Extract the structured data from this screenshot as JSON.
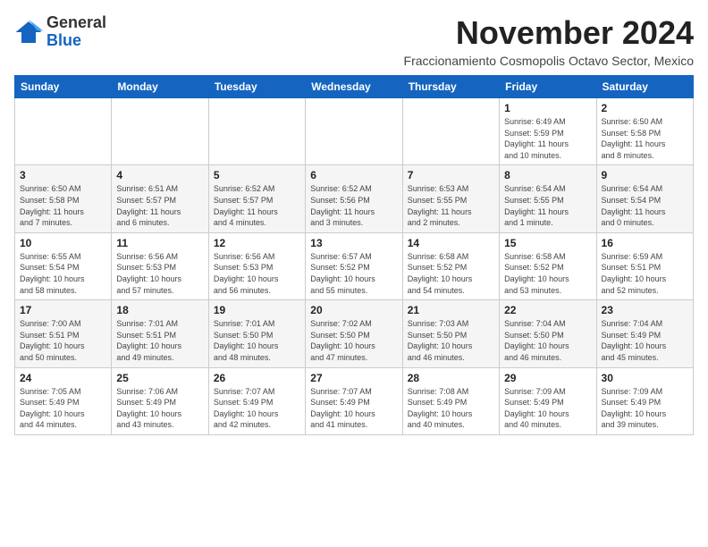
{
  "header": {
    "logo_general": "General",
    "logo_blue": "Blue",
    "month_title": "November 2024",
    "subtitle": "Fraccionamiento Cosmopolis Octavo Sector, Mexico"
  },
  "days_of_week": [
    "Sunday",
    "Monday",
    "Tuesday",
    "Wednesday",
    "Thursday",
    "Friday",
    "Saturday"
  ],
  "weeks": [
    [
      {
        "day": "",
        "info": ""
      },
      {
        "day": "",
        "info": ""
      },
      {
        "day": "",
        "info": ""
      },
      {
        "day": "",
        "info": ""
      },
      {
        "day": "",
        "info": ""
      },
      {
        "day": "1",
        "info": "Sunrise: 6:49 AM\nSunset: 5:59 PM\nDaylight: 11 hours and 10 minutes."
      },
      {
        "day": "2",
        "info": "Sunrise: 6:50 AM\nSunset: 5:58 PM\nDaylight: 11 hours and 8 minutes."
      }
    ],
    [
      {
        "day": "3",
        "info": "Sunrise: 6:50 AM\nSunset: 5:58 PM\nDaylight: 11 hours and 7 minutes."
      },
      {
        "day": "4",
        "info": "Sunrise: 6:51 AM\nSunset: 5:57 PM\nDaylight: 11 hours and 6 minutes."
      },
      {
        "day": "5",
        "info": "Sunrise: 6:52 AM\nSunset: 5:57 PM\nDaylight: 11 hours and 4 minutes."
      },
      {
        "day": "6",
        "info": "Sunrise: 6:52 AM\nSunset: 5:56 PM\nDaylight: 11 hours and 3 minutes."
      },
      {
        "day": "7",
        "info": "Sunrise: 6:53 AM\nSunset: 5:55 PM\nDaylight: 11 hours and 2 minutes."
      },
      {
        "day": "8",
        "info": "Sunrise: 6:54 AM\nSunset: 5:55 PM\nDaylight: 11 hours and 1 minute."
      },
      {
        "day": "9",
        "info": "Sunrise: 6:54 AM\nSunset: 5:54 PM\nDaylight: 11 hours and 0 minutes."
      }
    ],
    [
      {
        "day": "10",
        "info": "Sunrise: 6:55 AM\nSunset: 5:54 PM\nDaylight: 10 hours and 58 minutes."
      },
      {
        "day": "11",
        "info": "Sunrise: 6:56 AM\nSunset: 5:53 PM\nDaylight: 10 hours and 57 minutes."
      },
      {
        "day": "12",
        "info": "Sunrise: 6:56 AM\nSunset: 5:53 PM\nDaylight: 10 hours and 56 minutes."
      },
      {
        "day": "13",
        "info": "Sunrise: 6:57 AM\nSunset: 5:52 PM\nDaylight: 10 hours and 55 minutes."
      },
      {
        "day": "14",
        "info": "Sunrise: 6:58 AM\nSunset: 5:52 PM\nDaylight: 10 hours and 54 minutes."
      },
      {
        "day": "15",
        "info": "Sunrise: 6:58 AM\nSunset: 5:52 PM\nDaylight: 10 hours and 53 minutes."
      },
      {
        "day": "16",
        "info": "Sunrise: 6:59 AM\nSunset: 5:51 PM\nDaylight: 10 hours and 52 minutes."
      }
    ],
    [
      {
        "day": "17",
        "info": "Sunrise: 7:00 AM\nSunset: 5:51 PM\nDaylight: 10 hours and 50 minutes."
      },
      {
        "day": "18",
        "info": "Sunrise: 7:01 AM\nSunset: 5:51 PM\nDaylight: 10 hours and 49 minutes."
      },
      {
        "day": "19",
        "info": "Sunrise: 7:01 AM\nSunset: 5:50 PM\nDaylight: 10 hours and 48 minutes."
      },
      {
        "day": "20",
        "info": "Sunrise: 7:02 AM\nSunset: 5:50 PM\nDaylight: 10 hours and 47 minutes."
      },
      {
        "day": "21",
        "info": "Sunrise: 7:03 AM\nSunset: 5:50 PM\nDaylight: 10 hours and 46 minutes."
      },
      {
        "day": "22",
        "info": "Sunrise: 7:04 AM\nSunset: 5:50 PM\nDaylight: 10 hours and 46 minutes."
      },
      {
        "day": "23",
        "info": "Sunrise: 7:04 AM\nSunset: 5:49 PM\nDaylight: 10 hours and 45 minutes."
      }
    ],
    [
      {
        "day": "24",
        "info": "Sunrise: 7:05 AM\nSunset: 5:49 PM\nDaylight: 10 hours and 44 minutes."
      },
      {
        "day": "25",
        "info": "Sunrise: 7:06 AM\nSunset: 5:49 PM\nDaylight: 10 hours and 43 minutes."
      },
      {
        "day": "26",
        "info": "Sunrise: 7:07 AM\nSunset: 5:49 PM\nDaylight: 10 hours and 42 minutes."
      },
      {
        "day": "27",
        "info": "Sunrise: 7:07 AM\nSunset: 5:49 PM\nDaylight: 10 hours and 41 minutes."
      },
      {
        "day": "28",
        "info": "Sunrise: 7:08 AM\nSunset: 5:49 PM\nDaylight: 10 hours and 40 minutes."
      },
      {
        "day": "29",
        "info": "Sunrise: 7:09 AM\nSunset: 5:49 PM\nDaylight: 10 hours and 40 minutes."
      },
      {
        "day": "30",
        "info": "Sunrise: 7:09 AM\nSunset: 5:49 PM\nDaylight: 10 hours and 39 minutes."
      }
    ]
  ]
}
